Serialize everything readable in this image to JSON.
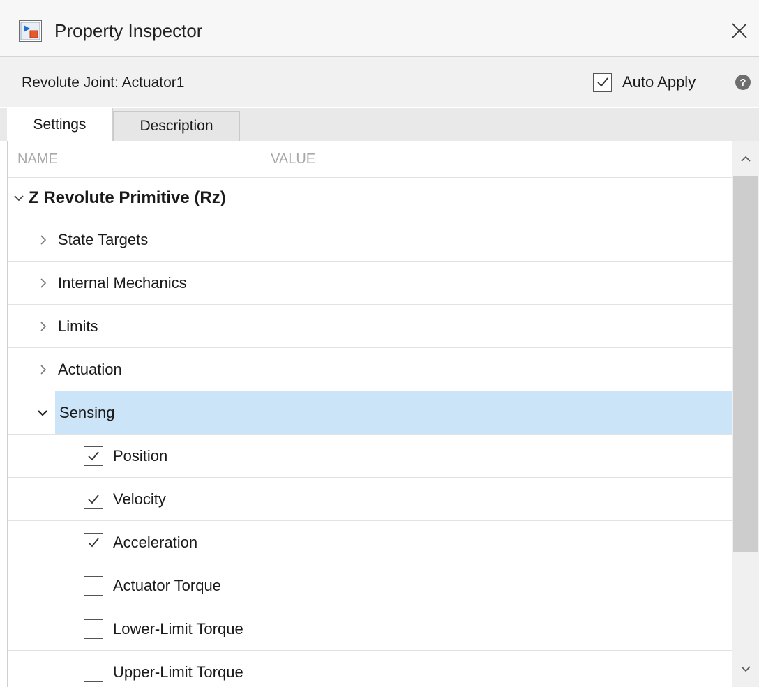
{
  "window": {
    "title": "Property Inspector",
    "app_icon": "simulink-block-icon",
    "close_icon": "close-icon"
  },
  "header": {
    "block_label": "Revolute Joint: Actuator1",
    "auto_apply_label": "Auto Apply",
    "auto_apply_checked": true,
    "help_icon": "help-icon"
  },
  "tabs": [
    {
      "label": "Settings",
      "active": true
    },
    {
      "label": "Description",
      "active": false
    }
  ],
  "table": {
    "col_name": "NAME",
    "col_value": "VALUE",
    "group": {
      "label": "Z Revolute Primitive (Rz)",
      "expanded": true
    },
    "sections": [
      {
        "label": "State Targets",
        "expanded": false
      },
      {
        "label": "Internal Mechanics",
        "expanded": false
      },
      {
        "label": "Limits",
        "expanded": false
      },
      {
        "label": "Actuation",
        "expanded": false
      },
      {
        "label": "Sensing",
        "expanded": true,
        "selected": true
      }
    ],
    "sensing_items": [
      {
        "label": "Position",
        "checked": true
      },
      {
        "label": "Velocity",
        "checked": true
      },
      {
        "label": "Acceleration",
        "checked": true
      },
      {
        "label": "Actuator Torque",
        "checked": false
      },
      {
        "label": "Lower-Limit Torque",
        "checked": false
      },
      {
        "label": "Upper-Limit Torque",
        "checked": false
      }
    ]
  },
  "colors": {
    "selection": "#cce4f7",
    "scroll_thumb": "#cdcdcd"
  }
}
